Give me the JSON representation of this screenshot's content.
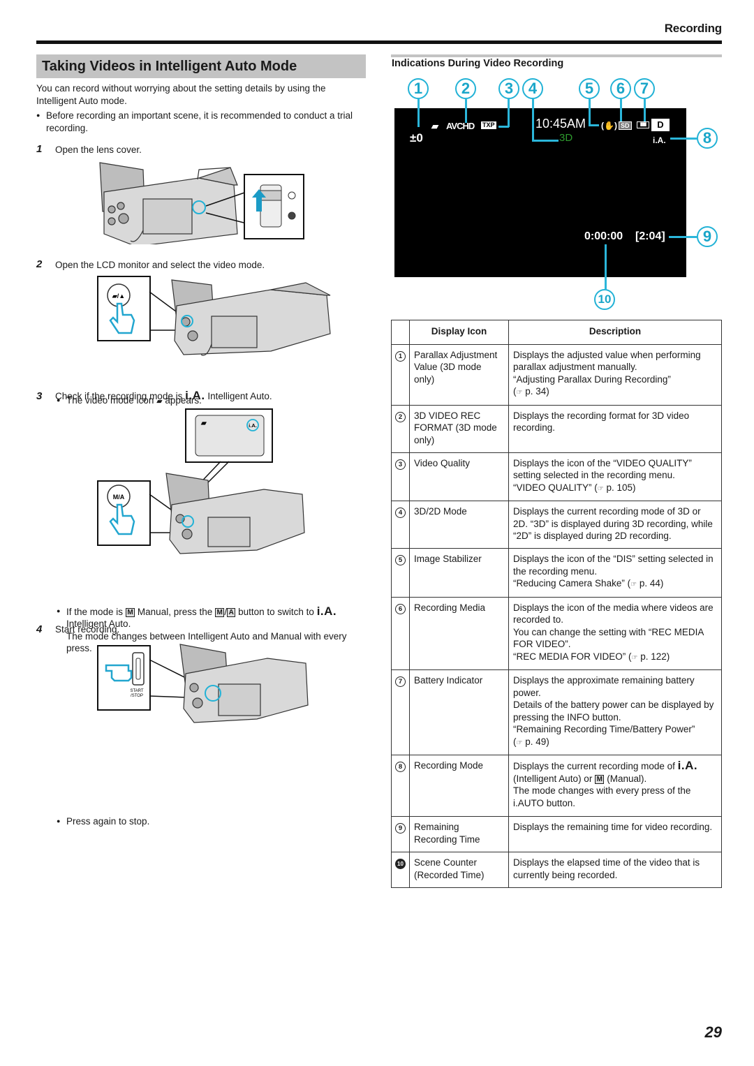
{
  "header": {
    "section": "Recording"
  },
  "left": {
    "title": "Taking Videos in Intelligent Auto Mode",
    "intro": "You can record without worrying about the setting details by using the Intelligent Auto mode.",
    "intro_bullet": "Before recording an important scene, it is recommended to conduct a trial recording.",
    "steps": [
      {
        "num": "1",
        "text": "Open the lens cover."
      },
      {
        "num": "2",
        "text": "Open the LCD monitor and select the video mode.",
        "bullet_pre": "The video mode icon",
        "bullet_post": "appears."
      },
      {
        "num": "3",
        "text_pre": "Check if the recording mode is",
        "text_post": "Intelligent Auto.",
        "bullet_1": "If the mode is",
        "bullet_2": "Manual, press the",
        "bullet_3": "button to switch to",
        "bullet_4": "Intelligent Auto.",
        "bullet_5": "The mode changes between Intelligent Auto and Manual with every press."
      },
      {
        "num": "4",
        "text": "Start recording.",
        "bullet": "Press again to stop."
      }
    ],
    "ia_symbol": "i.A.",
    "m_symbol": "M",
    "a_symbol": "A",
    "illus": {
      "start_stop_label_1": "START",
      "start_stop_label_2": "/STOP",
      "lcd_ia": "i.A."
    }
  },
  "right": {
    "subtitle": "Indications During Video Recording",
    "screen": {
      "parallax": "±0",
      "format": "AVCHD",
      "quality": "TXP",
      "time": "10:45AM",
      "mode3d": "3D",
      "media": "SD",
      "battery_bars": 3,
      "d_label": "D",
      "ia": "i.A.",
      "counter": "0:00:00",
      "remaining": "[2:04]",
      "mode3d_color": "#2e9a2e",
      "accent_color": "#22b2d6"
    },
    "callouts": [
      "1",
      "2",
      "3",
      "4",
      "5",
      "6",
      "7",
      "8",
      "9",
      "10"
    ],
    "table": {
      "headers": {
        "icon": "Display Icon",
        "desc": "Description"
      },
      "rows": [
        {
          "n": "1",
          "icon": "Parallax Adjustment Value (3D mode only)",
          "desc": "Displays the adjusted value when performing parallax adjustment manually.",
          "ref": "“Adjusting Parallax During Recording”",
          "page": "p. 34"
        },
        {
          "n": "2",
          "icon": "3D VIDEO REC FORMAT (3D mode only)",
          "desc": "Displays the recording format for 3D video recording."
        },
        {
          "n": "3",
          "icon": "Video Quality",
          "desc": "Displays the icon of the “VIDEO QUALITY” setting selected in the recording menu.",
          "ref": "“VIDEO QUALITY”",
          "page": "p. 105"
        },
        {
          "n": "4",
          "icon": "3D/2D Mode",
          "desc": "Displays the current recording mode of 3D or 2D. “3D” is displayed during 3D recording, while “2D” is displayed during 2D recording."
        },
        {
          "n": "5",
          "icon": "Image Stabilizer",
          "desc": "Displays the icon of the “DIS” setting selected in the recording menu.",
          "ref": "“Reducing Camera Shake”",
          "page": "p. 44"
        },
        {
          "n": "6",
          "icon": "Recording Media",
          "desc": "Displays the icon of the media where videos are recorded to.",
          "desc2": "You can change the setting with “REC MEDIA FOR VIDEO”.",
          "ref": "“REC MEDIA FOR VIDEO”",
          "page": "p. 122"
        },
        {
          "n": "7",
          "icon": "Battery Indicator",
          "desc": "Displays the approximate remaining battery power.",
          "desc2": "Details of the battery power can be displayed by pressing the INFO button.",
          "ref": "“Remaining Recording Time/Battery Power”",
          "page": "p. 49"
        },
        {
          "n": "8",
          "icon": "Recording Mode",
          "desc_pre": "Displays the current recording mode of",
          "desc_mid": "(Intelligent Auto) or",
          "desc_post": "(Manual).",
          "desc2": "The mode changes with every press of the i.AUTO button."
        },
        {
          "n": "9",
          "icon": "Remaining Recording Time",
          "desc": "Displays the remaining time for video recording."
        },
        {
          "n": "10",
          "icon": "Scene Counter (Recorded Time)",
          "desc": "Displays the elapsed time of the video that is currently being recorded."
        }
      ],
      "ref_glyph": "☞"
    }
  },
  "footer": {
    "page_number": "29"
  }
}
